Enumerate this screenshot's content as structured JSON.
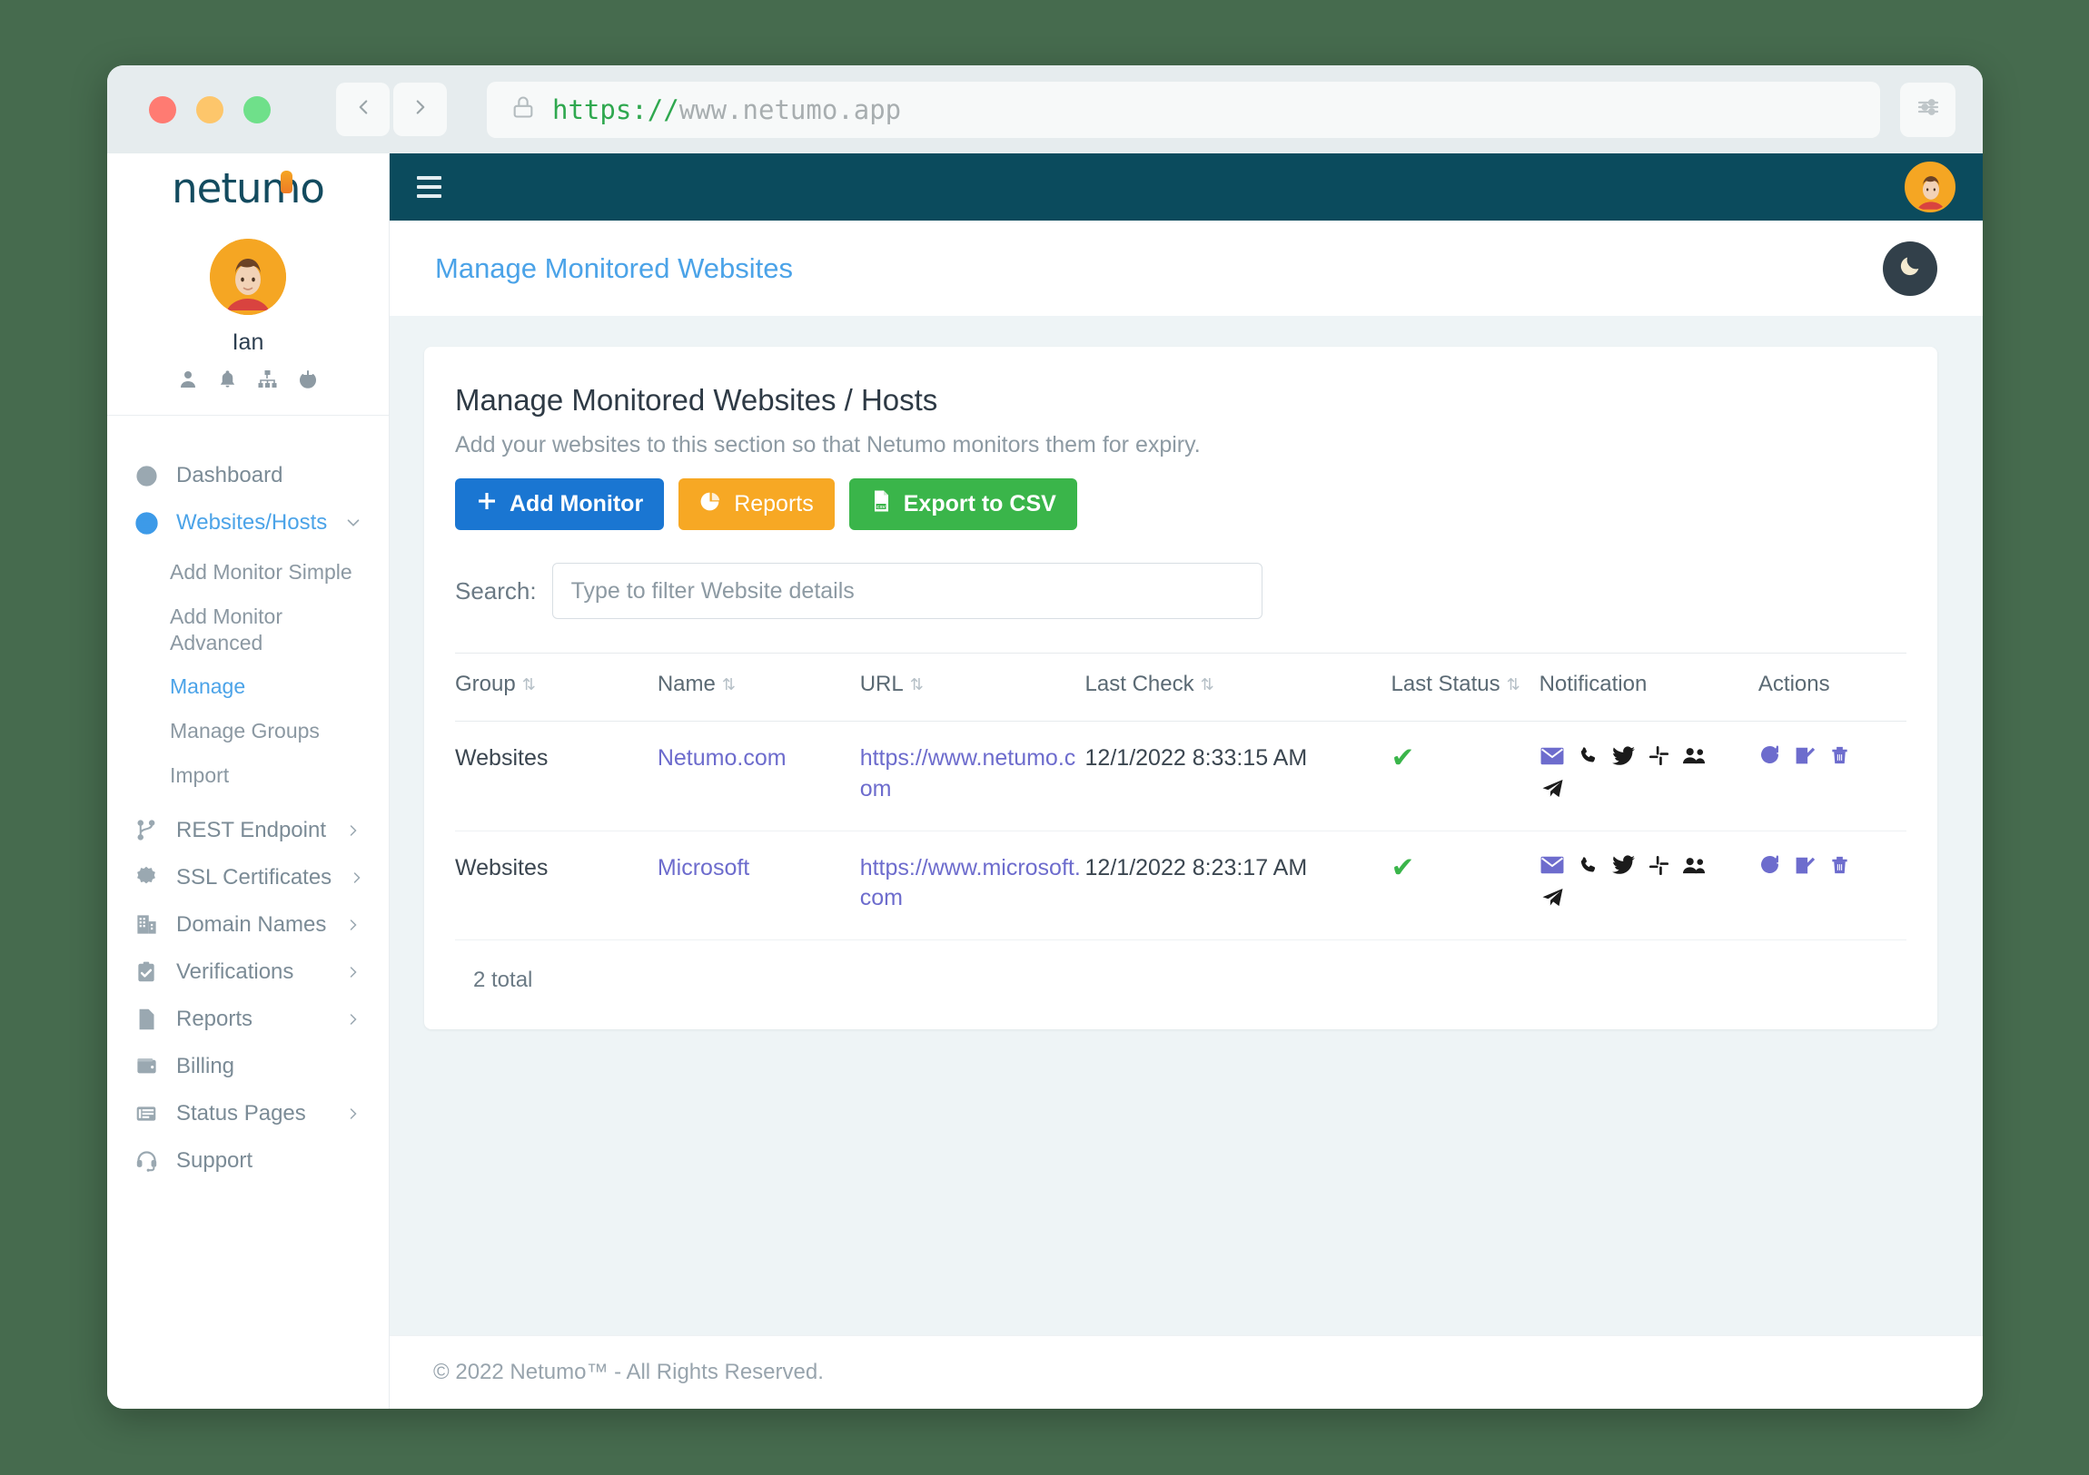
{
  "browser": {
    "url_scheme": "https://",
    "url_host": "www.netumo.app",
    "back_icon": "chevron-left-icon",
    "forward_icon": "chevron-right-icon",
    "lock_icon": "lock-icon",
    "prefs_icon": "sliders-icon"
  },
  "sidebar": {
    "brand": "netumo",
    "profile": {
      "name": "Ian",
      "icons": [
        "user-icon",
        "bell-icon",
        "sitemap-icon",
        "power-icon"
      ]
    },
    "items": [
      {
        "label": "Dashboard",
        "icon": "gauge-icon",
        "active": false,
        "expandable": false
      },
      {
        "label": "Websites/Hosts",
        "icon": "globe-icon",
        "active": true,
        "expandable": true,
        "children": [
          {
            "label": "Add Monitor Simple",
            "active": false
          },
          {
            "label": "Add Monitor Advanced",
            "active": false
          },
          {
            "label": "Manage",
            "active": true
          },
          {
            "label": "Manage Groups",
            "active": false
          },
          {
            "label": "Import",
            "active": false
          }
        ]
      },
      {
        "label": "REST Endpoint",
        "icon": "nodes-icon",
        "active": false,
        "expandable": true
      },
      {
        "label": "SSL Certificates",
        "icon": "certificate-icon",
        "active": false,
        "expandable": true
      },
      {
        "label": "Domain Names",
        "icon": "building-icon",
        "active": false,
        "expandable": true
      },
      {
        "label": "Verifications",
        "icon": "clipboard-check-icon",
        "active": false,
        "expandable": true
      },
      {
        "label": "Reports",
        "icon": "file-lines-icon",
        "active": false,
        "expandable": true
      },
      {
        "label": "Billing",
        "icon": "wallet-icon",
        "active": false,
        "expandable": false
      },
      {
        "label": "Status Pages",
        "icon": "list-card-icon",
        "active": false,
        "expandable": true
      },
      {
        "label": "Support",
        "icon": "headset-icon",
        "active": false,
        "expandable": false
      }
    ]
  },
  "topbar": {
    "menu_icon": "hamburger-icon",
    "avatar": "user-avatar"
  },
  "subheader": {
    "title": "Manage Monitored Websites",
    "theme_toggle_icon": "moon-icon"
  },
  "card": {
    "title": "Manage Monitored Websites / Hosts",
    "subtitle": "Add your websites to this section so that Netumo monitors them for expiry.",
    "buttons": [
      {
        "label": "Add Monitor",
        "icon": "plus-icon",
        "style": "primary"
      },
      {
        "label": "Reports",
        "icon": "pie-chart-icon",
        "style": "warning"
      },
      {
        "label": "Export to CSV",
        "icon": "csv-file-icon",
        "style": "success"
      }
    ],
    "search": {
      "label": "Search:",
      "placeholder": "Type to filter Website details",
      "value": ""
    },
    "table": {
      "columns": [
        {
          "label": "Group",
          "sortable": true
        },
        {
          "label": "Name",
          "sortable": true
        },
        {
          "label": "URL",
          "sortable": true
        },
        {
          "label": "Last Check",
          "sortable": true
        },
        {
          "label": "Last Status",
          "sortable": true
        },
        {
          "label": "Notification",
          "sortable": false
        },
        {
          "label": "Actions",
          "sortable": false
        }
      ],
      "rows": [
        {
          "group": "Websites",
          "name": "Netumo.com",
          "url": "https://www.netumo.com",
          "last_check": "12/1/2022 8:33:15 AM",
          "last_status": "ok",
          "notification_icons": [
            "mail-icon",
            "phone-icon",
            "twitter-icon",
            "slack-icon",
            "users-icon",
            "telegram-icon"
          ],
          "action_icons": [
            "refresh-icon",
            "edit-icon",
            "delete-icon"
          ]
        },
        {
          "group": "Websites",
          "name": "Microsoft",
          "url": "https://www.microsoft.com",
          "last_check": "12/1/2022 8:23:17 AM",
          "last_status": "ok",
          "notification_icons": [
            "mail-icon",
            "phone-icon",
            "twitter-icon",
            "slack-icon",
            "users-icon",
            "telegram-icon"
          ],
          "action_icons": [
            "refresh-icon",
            "edit-icon",
            "delete-icon"
          ]
        }
      ],
      "total_label": "2 total"
    }
  },
  "footer": {
    "copyright": "© 2022 Netumo™ - All Rights Reserved."
  },
  "colors": {
    "topbar": "#0b4b5d",
    "accent_blue": "#4ba3e8",
    "link_purple": "#6d6ccd",
    "success_green": "#3ab54a",
    "warning_orange": "#f7a824",
    "primary_blue": "#1a76d2",
    "avatar_orange": "#f5a623"
  }
}
